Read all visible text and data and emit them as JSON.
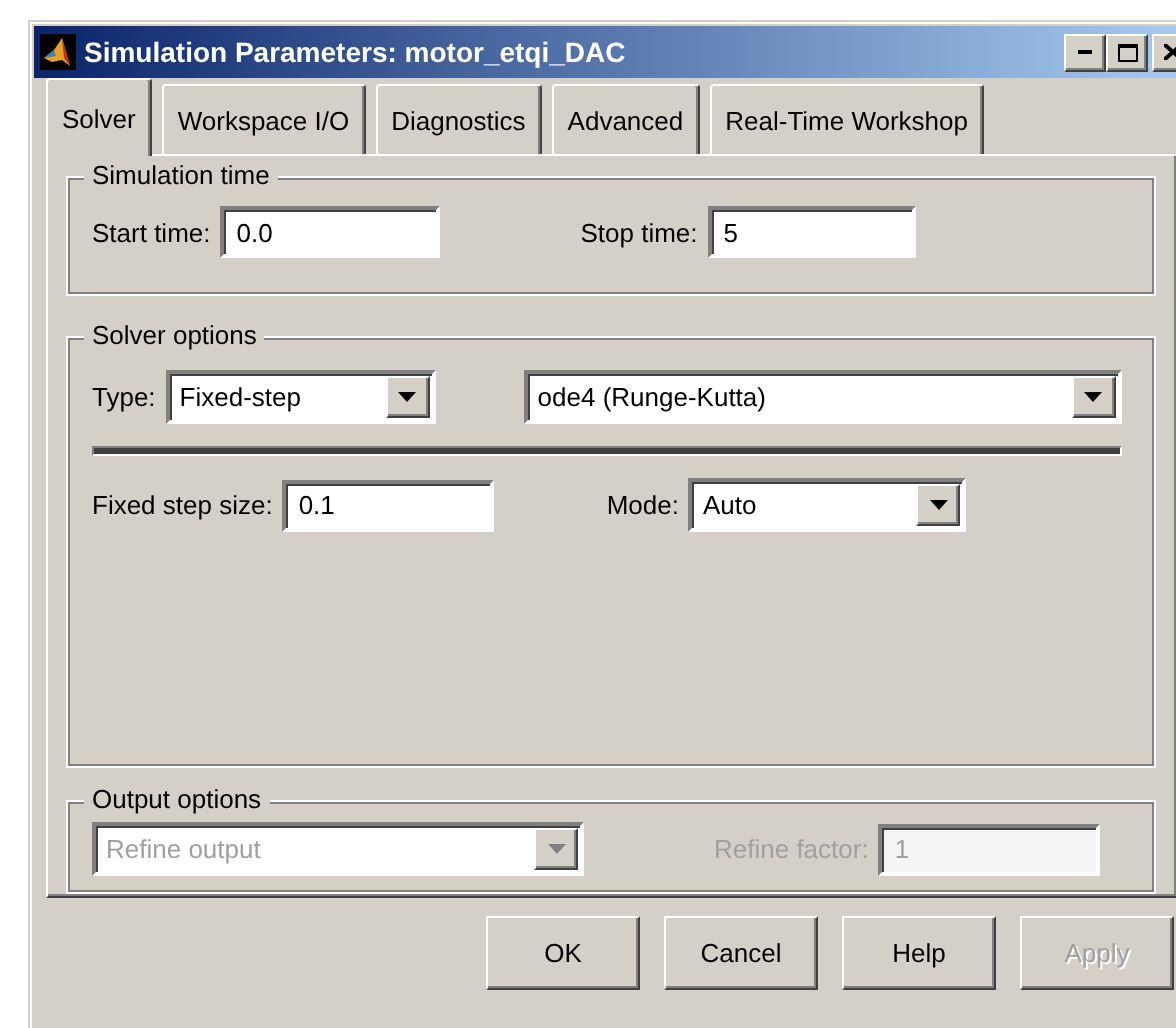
{
  "window": {
    "title": "Simulation Parameters: motor_etqi_DAC"
  },
  "tabs": [
    {
      "label": "Solver",
      "selected": true
    },
    {
      "label": "Workspace I/O",
      "selected": false
    },
    {
      "label": "Diagnostics",
      "selected": false
    },
    {
      "label": "Advanced",
      "selected": false
    },
    {
      "label": "Real-Time Workshop",
      "selected": false
    }
  ],
  "simulation_time": {
    "title": "Simulation time",
    "start_label": "Start time:",
    "start_value": "0.0",
    "stop_label": "Stop time:",
    "stop_value": "5"
  },
  "solver_options": {
    "title": "Solver options",
    "type_label": "Type:",
    "type_value": "Fixed-step",
    "solver_value": "ode4 (Runge-Kutta)",
    "step_label": "Fixed step size:",
    "step_value": "0.1",
    "mode_label": "Mode:",
    "mode_value": "Auto"
  },
  "output_options": {
    "title": "Output options",
    "refine_value": "Refine output",
    "refine_disabled": true,
    "factor_label": "Refine factor:",
    "factor_value": "1",
    "factor_disabled": true
  },
  "buttons": [
    {
      "label": "OK",
      "disabled": false
    },
    {
      "label": "Cancel",
      "disabled": false
    },
    {
      "label": "Help",
      "disabled": false
    },
    {
      "label": "Apply",
      "disabled": true
    }
  ]
}
